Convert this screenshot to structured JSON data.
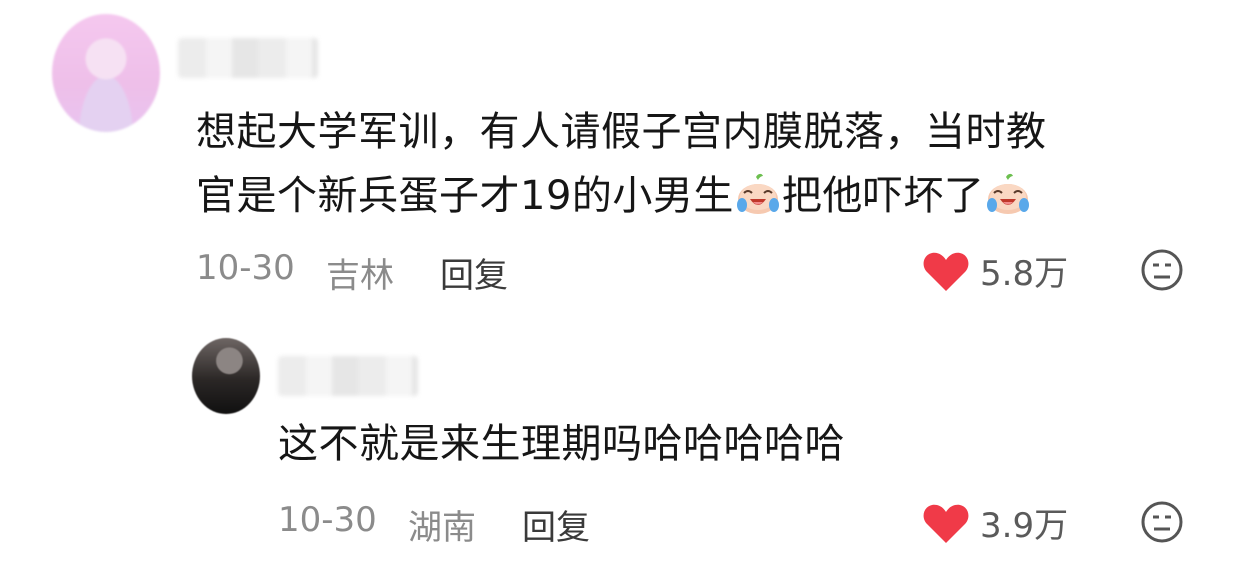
{
  "comments": [
    {
      "text_line1": "想起大学军训，有人请假子宫内膜脱落，当时教",
      "text_line2_a": "官是个新兵蛋子才19的小男生",
      "text_line2_b": "把他吓坏了",
      "date": "10-30",
      "location": "吉林",
      "reply_label": "回复",
      "likes": "5.8万",
      "emoji_icon": "crying-laughing-emoji-icon"
    },
    {
      "text": "这不就是来生理期吗哈哈哈哈哈",
      "date": "10-30",
      "location": "湖南",
      "reply_label": "回复",
      "likes": "3.9万"
    }
  ],
  "colors": {
    "heart": "#f03a48",
    "meta_text": "#8b8b8b",
    "body_text": "#161616"
  }
}
